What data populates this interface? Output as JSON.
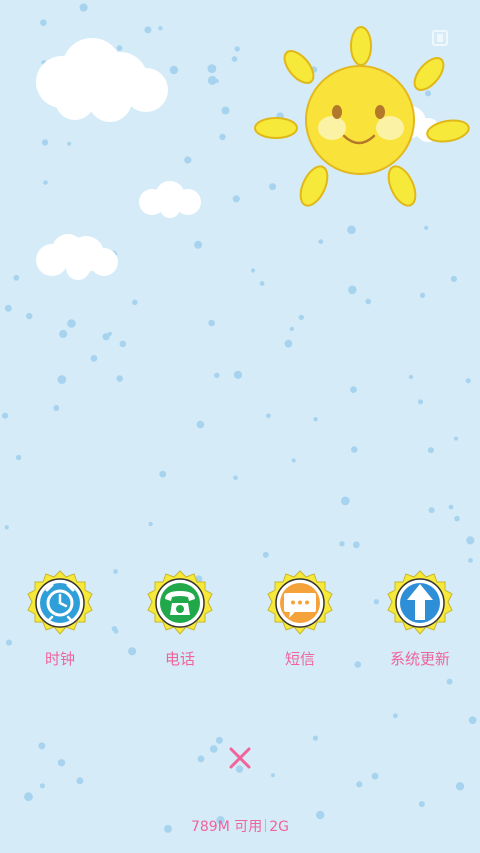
{
  "apps": [
    {
      "label": "时钟",
      "icon": "alarm-clock-icon",
      "color": "#2e9fd8"
    },
    {
      "label": "电话",
      "icon": "telephone-icon",
      "color": "#20a84a"
    },
    {
      "label": "短信",
      "icon": "message-bubble-icon",
      "color": "#f5a23a"
    },
    {
      "label": "系统更新",
      "icon": "up-arrow-icon",
      "color": "#2f8fd6"
    }
  ],
  "close_icon": "close-x-icon",
  "memory": {
    "available": "789M 可用",
    "network": "2G"
  },
  "colors": {
    "background": "#d5ecf8",
    "accent_pink": "#f0639b",
    "badge_yellow": "#f7e93a"
  }
}
